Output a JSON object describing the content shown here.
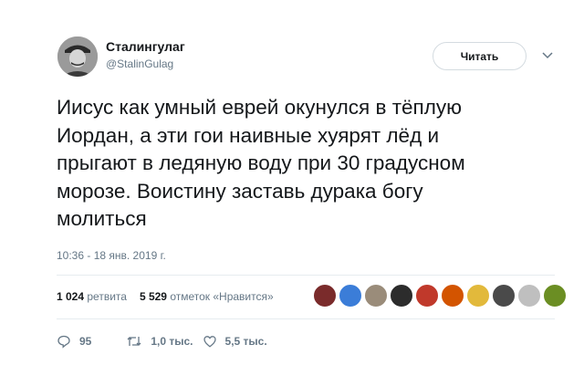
{
  "author": {
    "name": "Сталингулаг",
    "handle": "@StalinGulag"
  },
  "follow_button": {
    "label": "Читать"
  },
  "tweet": {
    "text": "Иисус как умный еврей окунулся в тёплую\nИордан, а эти гои наивные хуярят лёд и\nпрыгают в ледяную воду при 30 градусном\nморозе. Воистину заставь дурака богу\nмолиться",
    "timestamp": "10:36 - 18 янв. 2019 г."
  },
  "stats": {
    "retweets_count": "1 024",
    "retweets_label": "ретвита",
    "likes_count": "5 529",
    "likes_label": "отметок «Нравится»"
  },
  "likers": [
    {
      "icon": "avatar",
      "color": "#7a2b2b"
    },
    {
      "icon": "avatar",
      "color": "#3b7dd8"
    },
    {
      "icon": "avatar",
      "color": "#9a8c7a"
    },
    {
      "icon": "avatar",
      "color": "#2c2c2c"
    },
    {
      "icon": "avatar",
      "color": "#c0392b"
    },
    {
      "icon": "avatar",
      "color": "#d35400"
    },
    {
      "icon": "avatar",
      "color": "#e2b93b"
    },
    {
      "icon": "avatar",
      "color": "#4a4a4a"
    },
    {
      "icon": "avatar",
      "color": "#bfbfbf"
    },
    {
      "icon": "avatar",
      "color": "#6b8e23"
    }
  ],
  "actions": {
    "replies": "95",
    "retweets": "1,0 тыс.",
    "likes": "5,5 тыс."
  }
}
